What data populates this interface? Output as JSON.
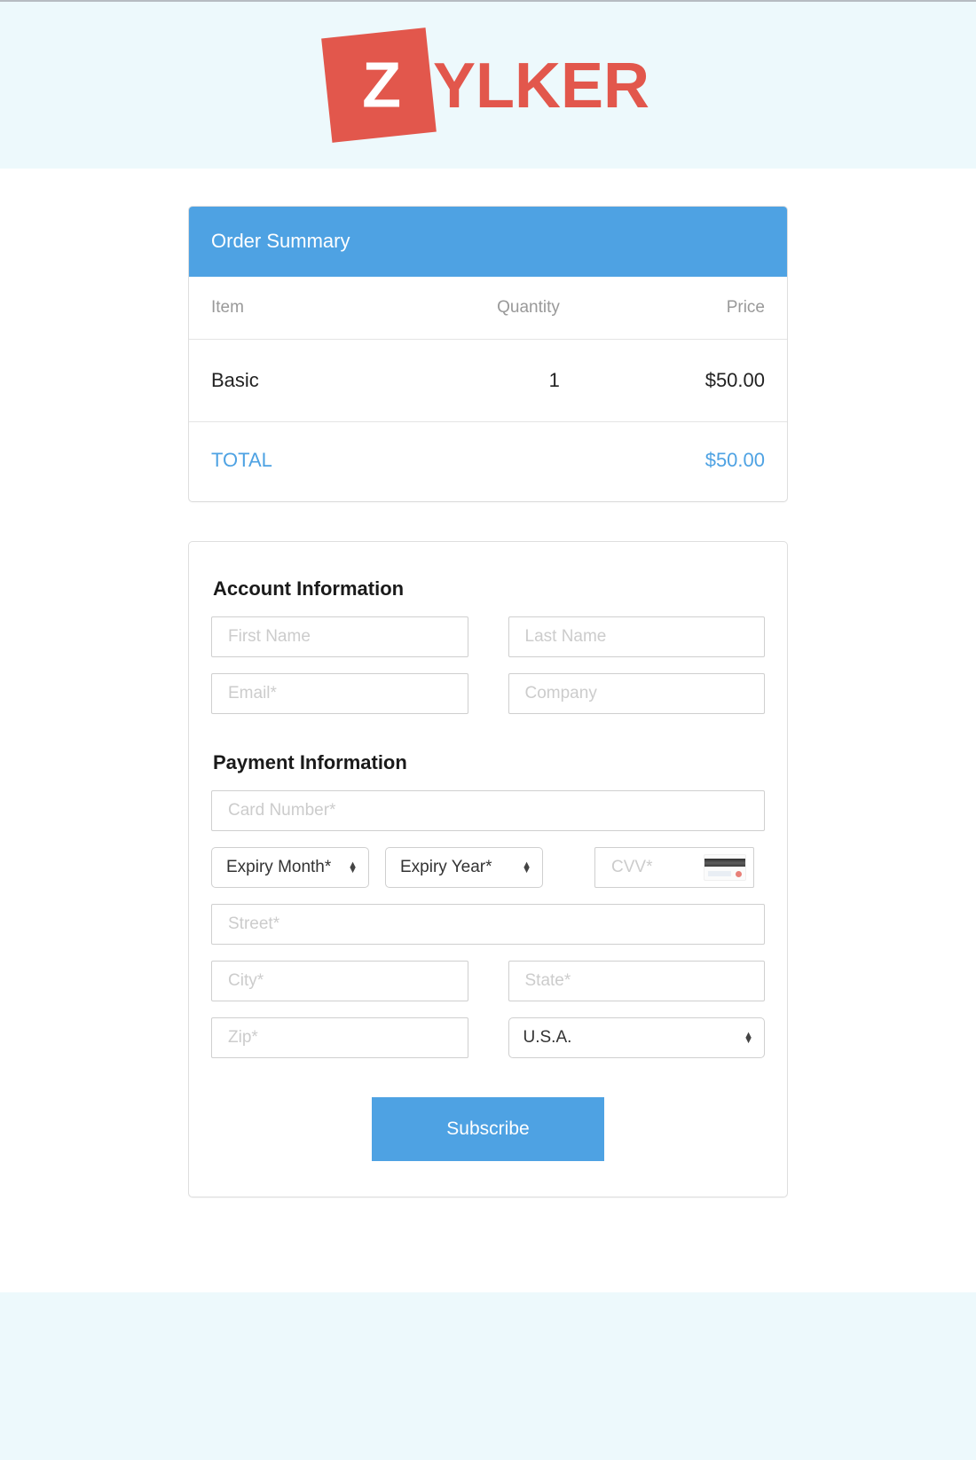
{
  "brand": {
    "logo_mark_letter": "Z",
    "logo_word": "YLKER",
    "logo_color": "#e2574c",
    "header_bg": "#edf9fc"
  },
  "order_summary": {
    "title": "Order Summary",
    "accent_color": "#4ea2e3",
    "columns": [
      "Item",
      "Quantity",
      "Price"
    ],
    "rows": [
      {
        "item": "Basic",
        "quantity": "1",
        "price": "$50.00"
      }
    ],
    "total_label": "TOTAL",
    "total_value": "$50.00"
  },
  "form": {
    "account_section_title": "Account Information",
    "payment_section_title": "Payment Information",
    "fields": {
      "first_name_placeholder": "First Name",
      "last_name_placeholder": "Last Name",
      "email_placeholder": "Email*",
      "company_placeholder": "Company",
      "card_number_placeholder": "Card Number*",
      "expiry_month_value": "Expiry Month*",
      "expiry_year_value": "Expiry Year*",
      "cvv_placeholder": "CVV*",
      "street_placeholder": "Street*",
      "city_placeholder": "City*",
      "state_placeholder": "State*",
      "zip_placeholder": "Zip*",
      "country_value": "U.S.A."
    },
    "submit_label": "Subscribe",
    "submit_color": "#4ea2e3"
  },
  "footer": {
    "bg": "#edf9fc"
  }
}
